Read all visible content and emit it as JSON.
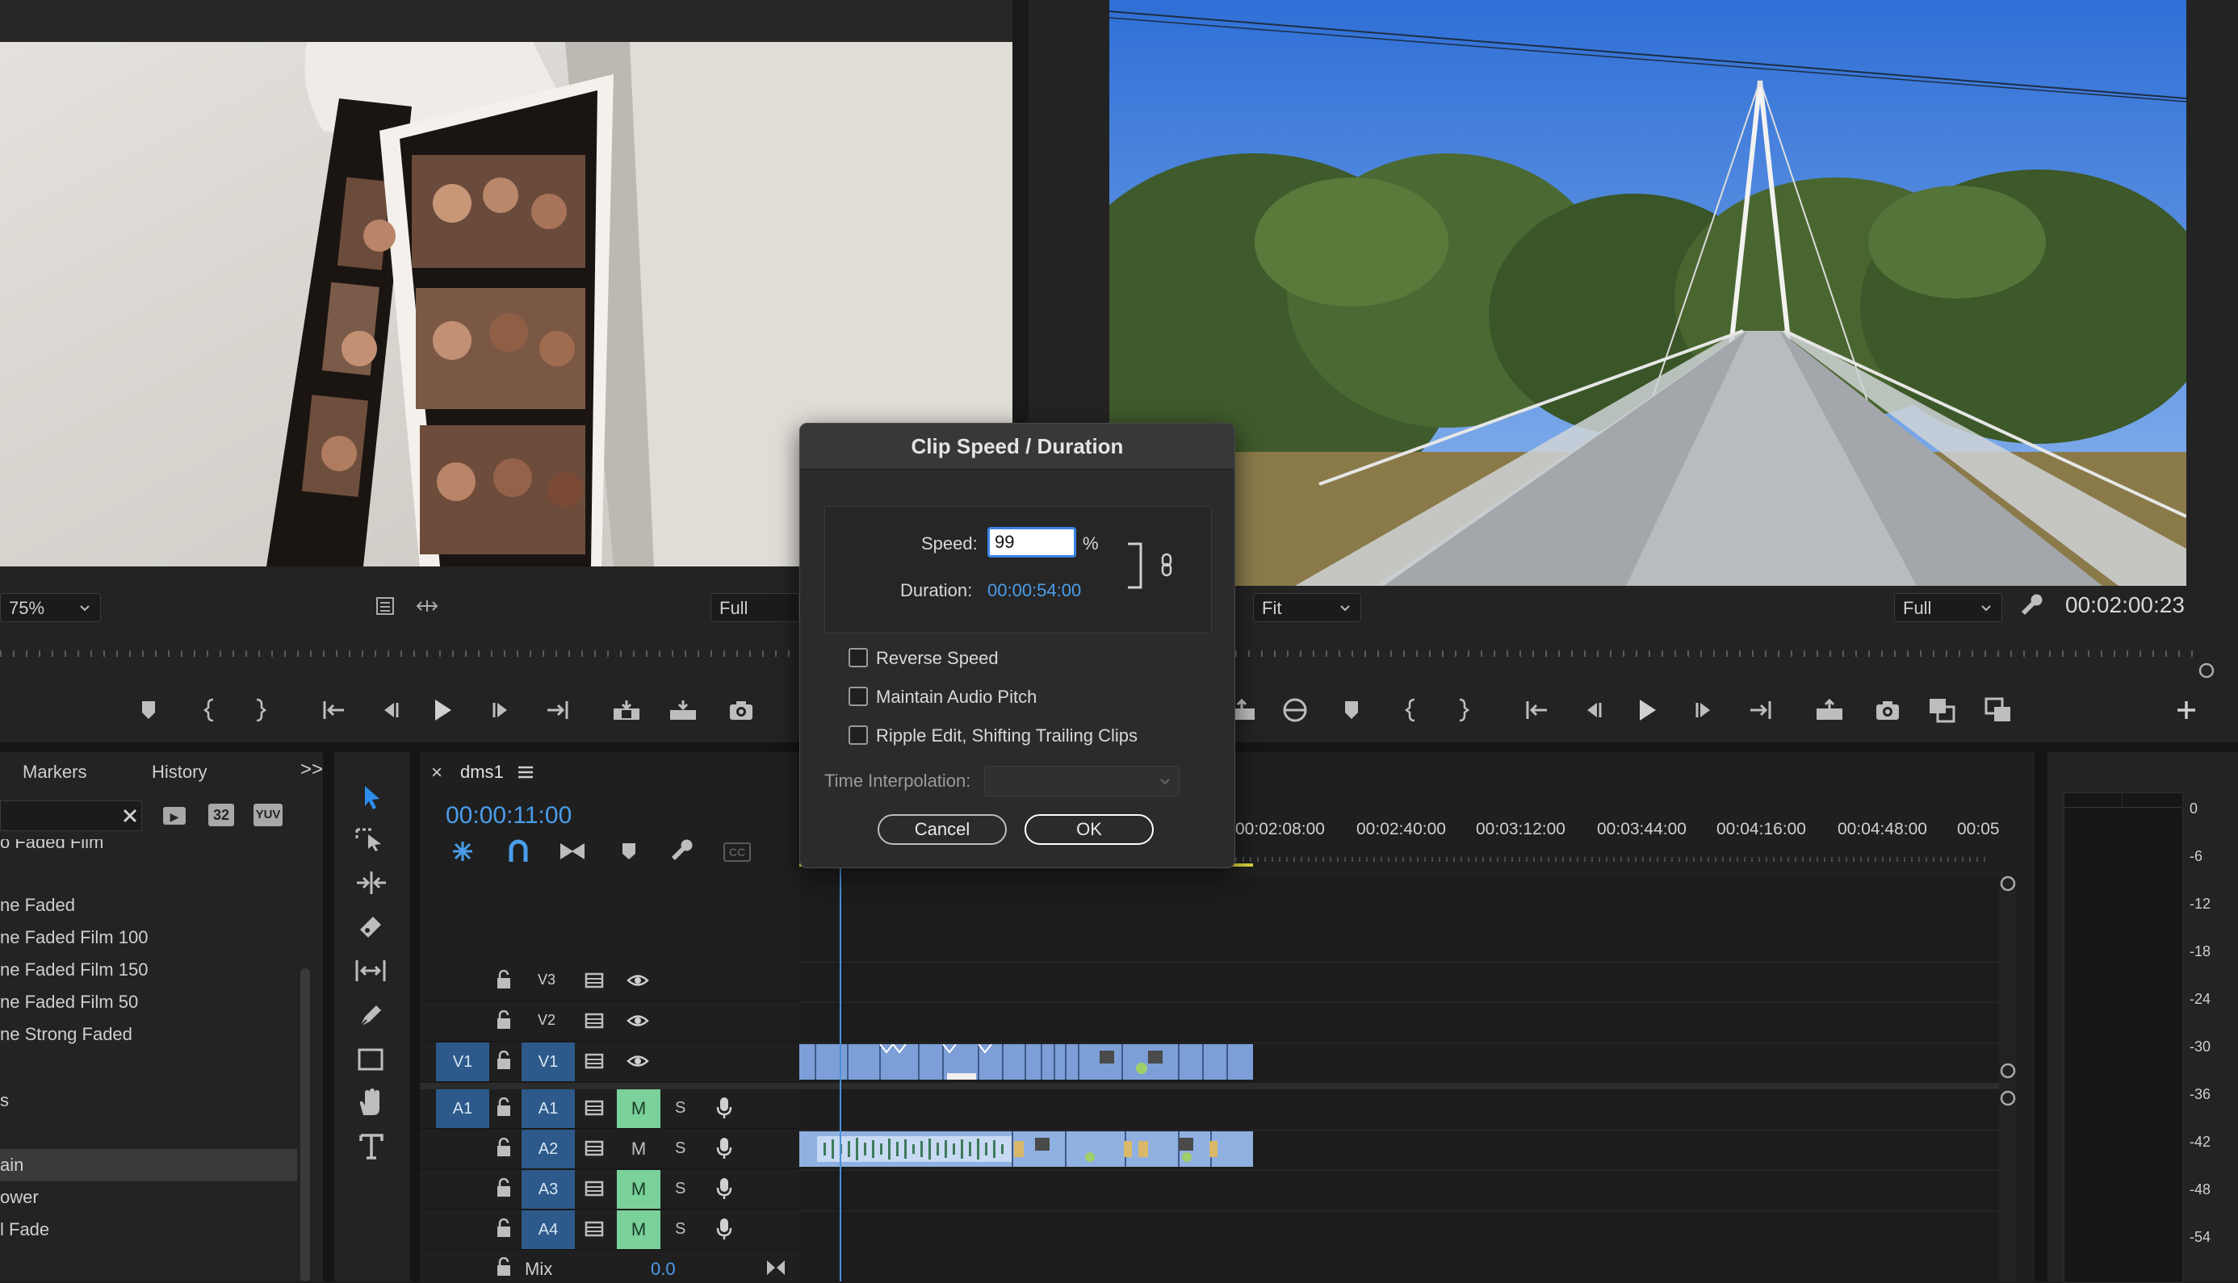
{
  "source_monitor": {
    "zoom": "75%",
    "resolution": "Full"
  },
  "program_monitor": {
    "fit": "Fit",
    "resolution": "Full",
    "timecode": "00:02:00:23"
  },
  "project_panel": {
    "tabs": [
      "Markers",
      "History"
    ],
    "overflow": ">>",
    "items": [
      "o Faded Film",
      "ne Faded",
      "ne Faded Film 100",
      "ne Faded Film 150",
      "ne Faded Film 50",
      "ne Strong Faded",
      "s",
      "ain",
      "ower",
      "l Fade"
    ],
    "icon_labels": [
      "32",
      "YUV"
    ]
  },
  "timeline": {
    "close": "×",
    "sequence_name": "dms1",
    "timecode": "00:00:11:00",
    "cc_label": "CC",
    "ruler_ticks": [
      "00:02:08:00",
      "00:02:40:00",
      "00:03:12:00",
      "00:03:44:00",
      "00:04:16:00",
      "00:04:48:00",
      "00:05"
    ],
    "video_tracks": [
      {
        "name": "V3"
      },
      {
        "name": "V2"
      },
      {
        "name": "V1",
        "source": "V1"
      }
    ],
    "audio_tracks": [
      {
        "name": "A1",
        "source": "A1",
        "mute": "M",
        "solo": "S"
      },
      {
        "name": "A2",
        "mute": "M",
        "solo": "S"
      },
      {
        "name": "A3",
        "mute": "M",
        "solo": "S"
      },
      {
        "name": "A4",
        "mute": "M",
        "solo": "S"
      }
    ],
    "mix_label": "Mix",
    "mix_value": "0.0"
  },
  "audio_meter": {
    "scale": [
      "0",
      "-6",
      "-12",
      "-18",
      "-24",
      "-30",
      "-36",
      "-42",
      "-48",
      "-54"
    ]
  },
  "dialog": {
    "title": "Clip Speed / Duration",
    "speed_label": "Speed:",
    "speed_value": "99",
    "percent": "%",
    "duration_label": "Duration:",
    "duration_value": "00:00:54:00",
    "checkboxes": [
      "Reverse Speed",
      "Maintain Audio Pitch",
      "Ripple Edit, Shifting Trailing Clips"
    ],
    "interp_label": "Time Interpolation:",
    "cancel": "Cancel",
    "ok": "OK"
  },
  "colors": {
    "accent_blue": "#2d8ceb",
    "timecode_blue": "#4a9dea",
    "mute_green": "#7ad19a",
    "clip_blue": "#7d9fd8",
    "audio_clip": "#8fb0e0"
  }
}
